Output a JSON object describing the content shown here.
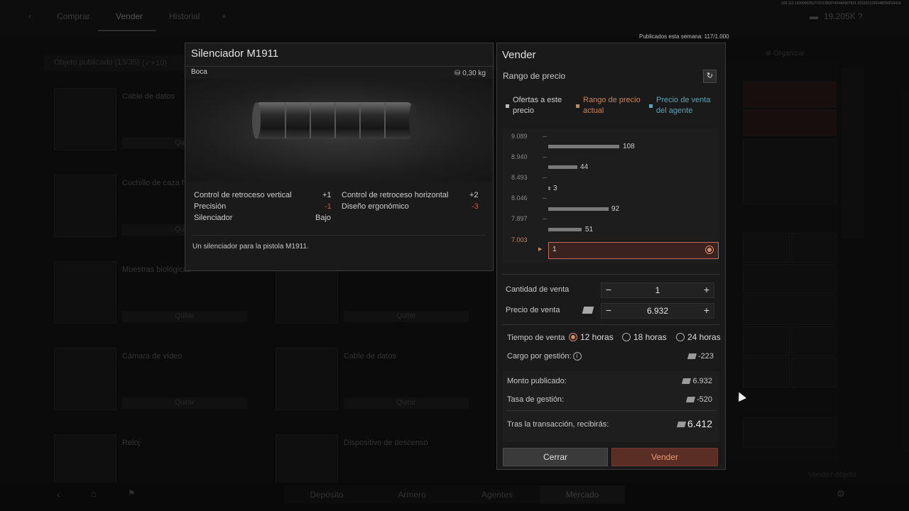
{
  "top_tabs": [
    "Comprar",
    "Vender",
    "Historial"
  ],
  "wallet": "19.205K",
  "published_week": "Publicados esta semana: 117/1.000",
  "bg": {
    "section_header": "Objeto publicado (13/35)",
    "section_count": "(✓×10)",
    "organize_label": "Organizar",
    "cards": [
      {
        "title": "Cable de datos",
        "btn": "Quitar"
      },
      {
        "title": "Cuchillo de caza he",
        "btn": "Quitar"
      },
      {
        "title": "Muestras biológicas",
        "btn": "Quitar"
      },
      {
        "title": "",
        "btn": "Quitar"
      },
      {
        "title": "Cámara de vídeo",
        "btn": "Quitar"
      },
      {
        "title": "Cable de datos",
        "btn": "Quitar"
      },
      {
        "title": "Reloj",
        "btn": ""
      },
      {
        "title": "Dispositivo de descenso",
        "btn": ""
      }
    ],
    "bottom_tabs": [
      "Depósito",
      "Armero",
      "Agentes",
      "Mercado"
    ],
    "sell_item_label": "Vender objeto"
  },
  "item": {
    "name": "Silenciador M1911",
    "slot": "Boca",
    "weight": "0,30 kg",
    "stats": [
      {
        "label": "Control de retroceso vertical",
        "value": "+1"
      },
      {
        "label": "Control de retroceso horizontal",
        "value": "+2"
      },
      {
        "label": "Precisión",
        "value": "-1"
      },
      {
        "label": "Diseño ergonómico",
        "value": "-3"
      },
      {
        "label": "Silenciador",
        "value": "Bajo"
      }
    ],
    "description": "Un silenciador para la pistola M1911."
  },
  "sell": {
    "title": "Vender",
    "range_title": "Rango de precio",
    "legend": [
      {
        "label": "Ofertas a este precio",
        "color": "#bdbdbd"
      },
      {
        "label": "Rango de precio actual",
        "color": "#c8855a"
      },
      {
        "label": "Precio de venta del agente",
        "color": "#5aa6b4"
      }
    ],
    "price_levels": [
      {
        "price": "9.089",
        "qty": "108"
      },
      {
        "price": "8.940",
        "qty": "44"
      },
      {
        "price": "8.493",
        "qty": "3"
      },
      {
        "price": "8.046",
        "qty": "92"
      },
      {
        "price": "7.897",
        "qty": "51"
      },
      {
        "price": "7.003",
        "qty": "1"
      }
    ],
    "quantity_label": "Cantidad de venta",
    "quantity": "1",
    "price_label": "Precio de venta",
    "price": "6.932",
    "time_label": "Tiempo de venta",
    "time_options": [
      "12 horas",
      "18 horas",
      "24 horas"
    ],
    "selected_time": "12 horas",
    "fee_label": "Cargo por gestión:",
    "fee_value": "-223",
    "published_amount_label": "Monto publicado:",
    "published_amount": "6.932",
    "mgmt_rate_label": "Tasa de gestión:",
    "mgmt_rate": "-520",
    "after_label": "Tras la transacción, recibirás:",
    "after_value": "6.412",
    "close_label": "Cerrar",
    "sell_label": "Vender"
  }
}
